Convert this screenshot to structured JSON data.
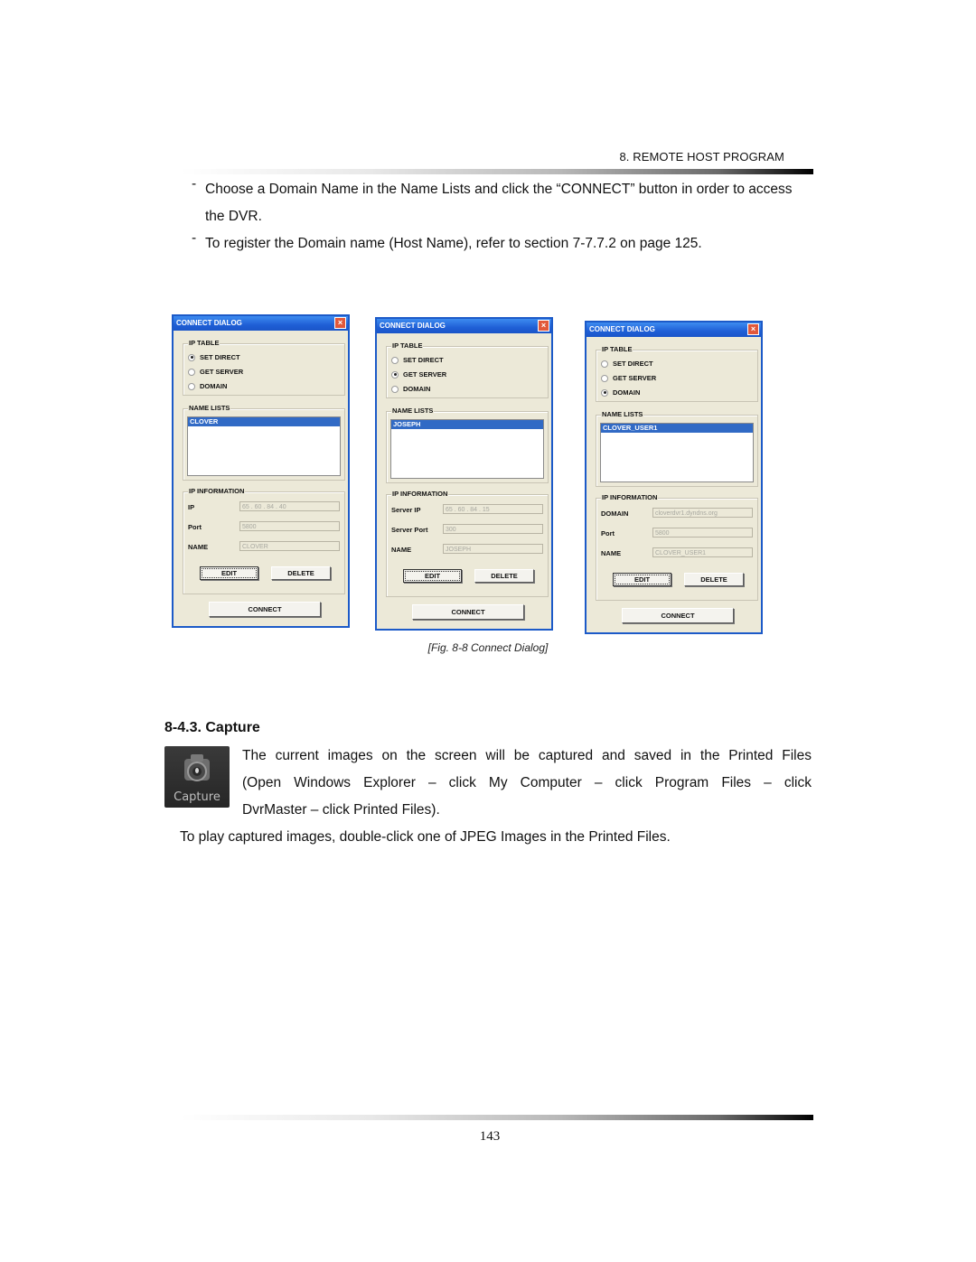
{
  "header": {
    "section": "8. REMOTE HOST PROGRAM"
  },
  "intro": {
    "bullets": [
      {
        "marker": "-",
        "text": "Choose a Domain Name in the Name Lists and click the “CONNECT” button in order to access the DVR."
      },
      {
        "marker": "-",
        "text": "To register the Domain name (Host Name), refer to section 7-7.7.2 on page 125."
      }
    ]
  },
  "dialogs": [
    {
      "title": "CONNECT DIALOG",
      "close": "×",
      "ip_table": {
        "legend": "IP TABLE",
        "options": [
          "SET DIRECT",
          "GET SERVER",
          "DOMAIN"
        ],
        "selected": 0
      },
      "name_lists": {
        "legend": "NAME LISTS",
        "items": [
          "CLOVER"
        ]
      },
      "ip_info": {
        "legend": "IP INFORMATION",
        "fields": [
          {
            "label": "IP",
            "value": "65  .  60  .  84  .  40"
          },
          {
            "label": "Port",
            "value": "5800"
          },
          {
            "label": "NAME",
            "value": "CLOVER"
          }
        ],
        "edit": "EDIT",
        "delete": "DELETE"
      },
      "connect": "CONNECT"
    },
    {
      "title": "CONNECT DIALOG",
      "close": "×",
      "ip_table": {
        "legend": "IP TABLE",
        "options": [
          "SET DIRECT",
          "GET SERVER",
          "DOMAIN"
        ],
        "selected": 1
      },
      "name_lists": {
        "legend": "NAME LISTS",
        "items": [
          "JOSEPH"
        ]
      },
      "ip_info": {
        "legend": "IP INFORMATION",
        "fields": [
          {
            "label": "Server IP",
            "value": "65  .  60  .  84  .  15"
          },
          {
            "label": "Server Port",
            "value": "300"
          },
          {
            "label": "NAME",
            "value": "JOSEPH"
          }
        ],
        "edit": "EDIT",
        "delete": "DELETE"
      },
      "connect": "CONNECT"
    },
    {
      "title": "CONNECT DIALOG",
      "close": "×",
      "ip_table": {
        "legend": "IP TABLE",
        "options": [
          "SET DIRECT",
          "GET SERVER",
          "DOMAIN"
        ],
        "selected": 2
      },
      "name_lists": {
        "legend": "NAME LISTS",
        "items": [
          "CLOVER_USER1"
        ]
      },
      "ip_info": {
        "legend": "IP INFORMATION",
        "fields": [
          {
            "label": "DOMAIN",
            "value": "cloverdvr1.dyndns.org"
          },
          {
            "label": "Port",
            "value": "5800"
          },
          {
            "label": "NAME",
            "value": "CLOVER_USER1"
          }
        ],
        "edit": "EDIT",
        "delete": "DELETE"
      },
      "connect": "CONNECT"
    }
  ],
  "figure_caption": "[Fig. 8-8 Connect Dialog]",
  "capture": {
    "title": "8-4.3. Capture",
    "icon_label": "Capture",
    "lines": [
      "The current images on the screen will be captured and saved in the Printed Files",
      "(Open Windows Explorer – click My Computer – click Program Files – click",
      "DvrMaster – click Printed Files)."
    ],
    "note": "To play captured images, double-click one of JPEG Images in the Printed Files."
  },
  "footer": {
    "page_number": "143"
  },
  "colors": {
    "title_bar": "#1f5fd6",
    "selection": "#316ac5",
    "dialog_bg": "#ece9d8",
    "close_button": "#e2583a"
  }
}
